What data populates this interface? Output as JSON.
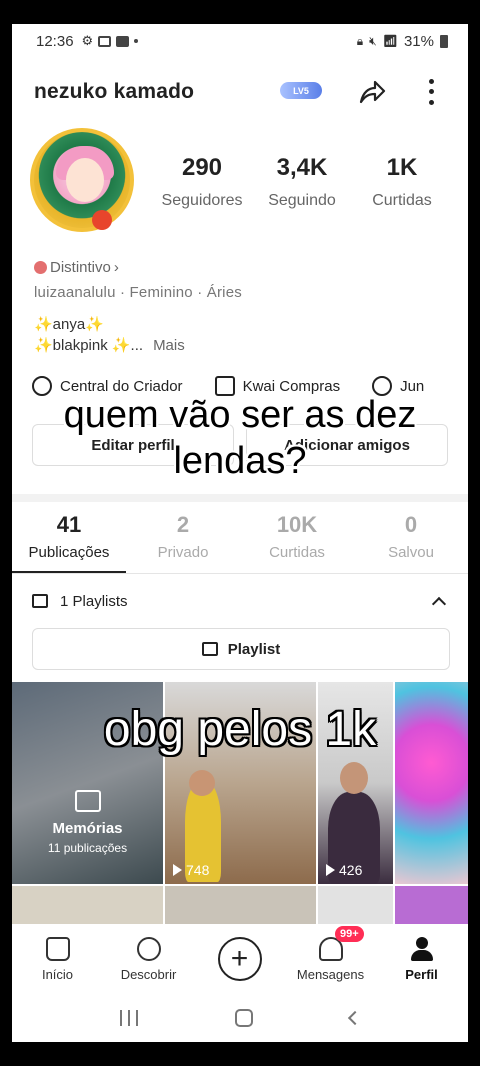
{
  "status_bar": {
    "time": "12:36",
    "battery": "31%"
  },
  "header": {
    "username": "nezuko kamado",
    "level_badge": "LV5"
  },
  "stats": [
    {
      "value": "290",
      "label": "Seguidores"
    },
    {
      "value": "3,4K",
      "label": "Seguindo"
    },
    {
      "value": "1K",
      "label": "Curtidas"
    }
  ],
  "profile": {
    "distintivo": "Distintivo",
    "info": "luizaanalulu · Feminino · Áries",
    "bio_line1": "✨anya✨",
    "bio_line2": "✨blakpink ✨...",
    "mais": "Mais"
  },
  "shortcuts": [
    "Central do Criador",
    "Kwai Compras",
    "Jun"
  ],
  "buttons": {
    "edit": "Editar perfil",
    "add_friends": "Adicionar amigos"
  },
  "tabs": [
    {
      "num": "41",
      "label": "Publicações"
    },
    {
      "num": "2",
      "label": "Privado"
    },
    {
      "num": "10K",
      "label": "Curtidas"
    },
    {
      "num": "0",
      "label": "Salvou"
    }
  ],
  "playlists": {
    "count_label": "1 Playlists",
    "button": "Playlist"
  },
  "grid": {
    "memorias_title": "Memórias",
    "memorias_sub": "11 publicações",
    "views": [
      "748",
      "426"
    ]
  },
  "captions": {
    "top": "quem vão ser as dez lendas?",
    "middle": "obg pelos 1k"
  },
  "nav": {
    "items": [
      "Início",
      "Descobrir",
      "Mensagens",
      "Perfil"
    ],
    "messages_badge": "99+"
  }
}
